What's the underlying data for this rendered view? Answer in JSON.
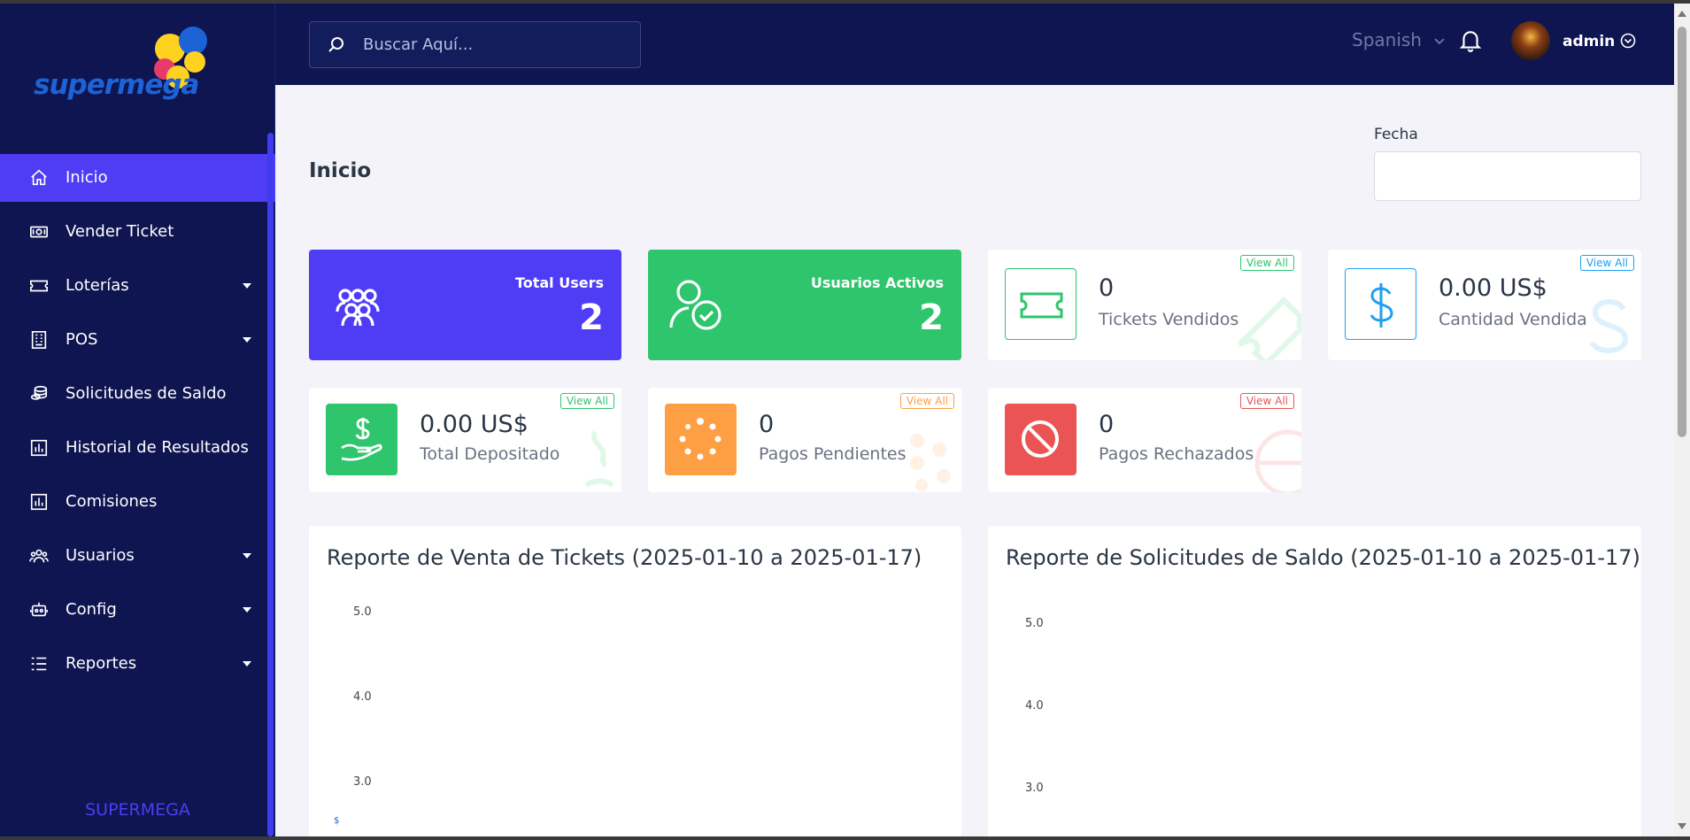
{
  "brand": {
    "logo_text": "supermega",
    "footer": "SUPERMEGA"
  },
  "sidebar": {
    "items": [
      {
        "label": "Inicio",
        "icon": "home-icon",
        "active": true,
        "expandable": false
      },
      {
        "label": "Vender Ticket",
        "icon": "money-icon",
        "active": false,
        "expandable": false
      },
      {
        "label": "Loterías",
        "icon": "ticket-icon",
        "active": false,
        "expandable": true
      },
      {
        "label": "POS",
        "icon": "building-icon",
        "active": false,
        "expandable": true
      },
      {
        "label": "Solicitudes de Saldo",
        "icon": "coins-icon",
        "active": false,
        "expandable": false
      },
      {
        "label": "Historial de Resultados",
        "icon": "bar-chart-icon",
        "active": false,
        "expandable": false
      },
      {
        "label": "Comisiones",
        "icon": "bar-chart-icon",
        "active": false,
        "expandable": false
      },
      {
        "label": "Usuarios",
        "icon": "users-icon",
        "active": false,
        "expandable": true
      },
      {
        "label": "Config",
        "icon": "robot-icon",
        "active": false,
        "expandable": true
      },
      {
        "label": "Reportes",
        "icon": "list-icon",
        "active": false,
        "expandable": true
      }
    ]
  },
  "header": {
    "search_placeholder": "Buscar Aquí...",
    "language": "Spanish",
    "username": "admin"
  },
  "main": {
    "title": "Inicio",
    "date_label": "Fecha",
    "date_value": ""
  },
  "stats": {
    "total_users": {
      "label": "Total Users",
      "value": "2"
    },
    "active_users": {
      "label": "Usuarios Activos",
      "value": "2"
    },
    "tickets_sold": {
      "label": "Tickets Vendidos",
      "value": "0",
      "link": "View All"
    },
    "amount_sold": {
      "label": "Cantidad Vendida",
      "value": "0.00 US$",
      "link": "View All"
    },
    "total_deposited": {
      "label": "Total Depositado",
      "value": "0.00 US$",
      "link": "View All"
    },
    "pending_payments": {
      "label": "Pagos Pendientes",
      "value": "0",
      "link": "View All"
    },
    "rejected_payments": {
      "label": "Pagos Rechazados",
      "value": "0",
      "link": "View All"
    }
  },
  "colors": {
    "sidebar_bg": "#0e1550",
    "accent": "#4f3cf5",
    "green": "#2ec56c",
    "orange": "#ff9f43",
    "red": "#ea5455",
    "blue": "#1e9ff2"
  },
  "chart_data": [
    {
      "type": "line",
      "title": "Reporte de Venta de Tickets (2025-01-10 a 2025-01-17)",
      "y_ticks": [
        "5.0",
        "4.0",
        "3.0"
      ],
      "series": []
    },
    {
      "type": "line",
      "title": "Reporte de Solicitudes de Saldo (2025-01-10 a 2025-01-17)",
      "y_ticks": [
        "5.0",
        "4.0",
        "3.0"
      ],
      "series": []
    }
  ]
}
